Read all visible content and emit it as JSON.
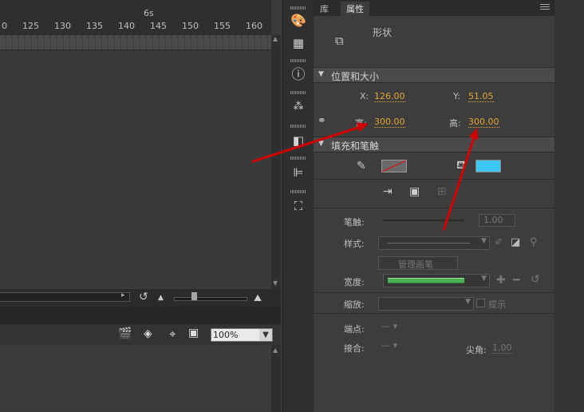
{
  "timeline": {
    "time_label": "6s",
    "ruler": [
      "0",
      "125",
      "130",
      "135",
      "140",
      "145",
      "150",
      "155",
      "160"
    ],
    "zoom": "100%"
  },
  "tabs": {
    "library": "库",
    "properties": "属性"
  },
  "object": {
    "type_label": "形状"
  },
  "position_size": {
    "title": "位置和大小",
    "x_label": "X:",
    "x_value": "126.00",
    "y_label": "Y:",
    "y_value": "51.05",
    "width_label": "宽:",
    "width_value": "300.00",
    "height_label": "高:",
    "height_value": "300.00"
  },
  "fill_stroke": {
    "title": "填充和笔触",
    "fill_color": "#3ec6f5",
    "stroke_label": "笔触:",
    "stroke_value": "1.00",
    "style_label": "样式:",
    "manage_brush": "管理画笔",
    "width_label": "宽度:",
    "scale_label": "缩放:",
    "hint_label": "提示",
    "cap_label": "端点:",
    "join_label": "接合:",
    "miter_label": "尖角:",
    "miter_value": "1.00"
  },
  "colors": {
    "annotation_arrow": "#d40000",
    "value_orange": "#e3a531"
  }
}
